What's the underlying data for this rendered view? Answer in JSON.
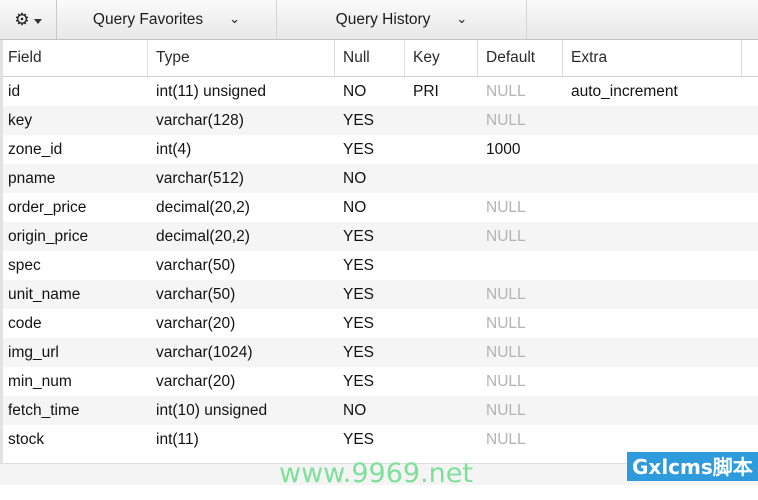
{
  "toolbar": {
    "gear_icon": "gear-icon",
    "gear_glyph": "⚙",
    "items": [
      {
        "label": "Query Favorites",
        "chevron": "⌄"
      },
      {
        "label": "Query History",
        "chevron": "⌄"
      }
    ]
  },
  "table": {
    "columns": [
      "Field",
      "Type",
      "Null",
      "Key",
      "Default",
      "Extra"
    ],
    "rows": [
      {
        "field": "id",
        "type": "int(11) unsigned",
        "null": "NO",
        "key": "PRI",
        "default": "NULL",
        "default_muted": true,
        "extra": "auto_increment"
      },
      {
        "field": "key",
        "type": "varchar(128)",
        "null": "YES",
        "key": "",
        "default": "NULL",
        "default_muted": true,
        "extra": ""
      },
      {
        "field": "zone_id",
        "type": "int(4)",
        "null": "YES",
        "key": "",
        "default": "1000",
        "default_muted": false,
        "extra": ""
      },
      {
        "field": "pname",
        "type": "varchar(512)",
        "null": "NO",
        "key": "",
        "default": "",
        "default_muted": false,
        "extra": ""
      },
      {
        "field": "order_price",
        "type": "decimal(20,2)",
        "null": "NO",
        "key": "",
        "default": "NULL",
        "default_muted": true,
        "extra": ""
      },
      {
        "field": "origin_price",
        "type": "decimal(20,2)",
        "null": "YES",
        "key": "",
        "default": "NULL",
        "default_muted": true,
        "extra": ""
      },
      {
        "field": "spec",
        "type": "varchar(50)",
        "null": "YES",
        "key": "",
        "default": "",
        "default_muted": false,
        "extra": ""
      },
      {
        "field": "unit_name",
        "type": "varchar(50)",
        "null": "YES",
        "key": "",
        "default": "NULL",
        "default_muted": true,
        "extra": ""
      },
      {
        "field": "code",
        "type": "varchar(20)",
        "null": "YES",
        "key": "",
        "default": "NULL",
        "default_muted": true,
        "extra": ""
      },
      {
        "field": "img_url",
        "type": "varchar(1024)",
        "null": "YES",
        "key": "",
        "default": "NULL",
        "default_muted": true,
        "extra": ""
      },
      {
        "field": "min_num",
        "type": "varchar(20)",
        "null": "YES",
        "key": "",
        "default": "NULL",
        "default_muted": true,
        "extra": ""
      },
      {
        "field": "fetch_time",
        "type": "int(10) unsigned",
        "null": "NO",
        "key": "",
        "default": "NULL",
        "default_muted": true,
        "extra": ""
      },
      {
        "field": "stock",
        "type": "int(11)",
        "null": "YES",
        "key": "",
        "default": "NULL",
        "default_muted": true,
        "extra": ""
      }
    ]
  },
  "watermarks": {
    "site": "www.9969.net",
    "site_color": "#7fe09a",
    "badge": "Gxlcms脚本",
    "badge_color": "#2e9bdc"
  }
}
